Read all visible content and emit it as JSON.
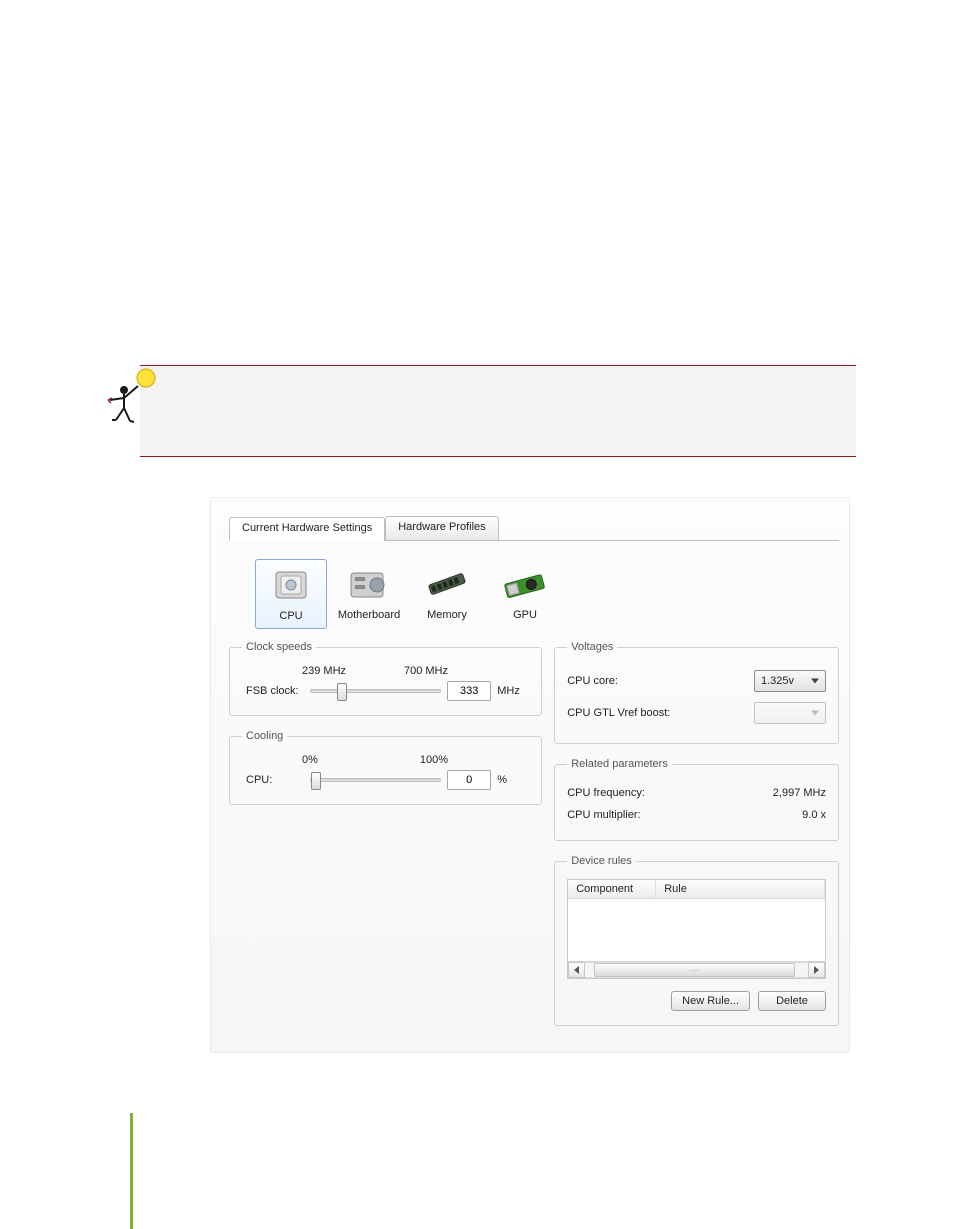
{
  "tabs": {
    "active": "Current Hardware Settings",
    "inactive": "Hardware Profiles"
  },
  "categories": [
    {
      "key": "cpu",
      "label": "CPU",
      "active": true
    },
    {
      "key": "motherboard",
      "label": "Motherboard",
      "active": false
    },
    {
      "key": "memory",
      "label": "Memory",
      "active": false
    },
    {
      "key": "gpu",
      "label": "GPU",
      "active": false
    }
  ],
  "clockSpeeds": {
    "legend": "Clock speeds",
    "fsb": {
      "label": "FSB clock:",
      "min": "239 MHz",
      "max": "700 MHz",
      "value": "333",
      "unit": "MHz",
      "thumbPercent": 20
    }
  },
  "cooling": {
    "legend": "Cooling",
    "cpu": {
      "label": "CPU:",
      "min": "0%",
      "max": "100%",
      "value": "0",
      "unit": "%",
      "thumbPercent": 0
    }
  },
  "voltages": {
    "legend": "Voltages",
    "rows": [
      {
        "label": "CPU core:",
        "value": "1.325v",
        "enabled": true
      },
      {
        "label": "CPU GTL Vref boost:",
        "value": "",
        "enabled": false
      }
    ]
  },
  "related": {
    "legend": "Related parameters",
    "rows": [
      {
        "label": "CPU frequency:",
        "value": "2,997 MHz"
      },
      {
        "label": "CPU multiplier:",
        "value": "9.0 x"
      }
    ]
  },
  "deviceRules": {
    "legend": "Device rules",
    "headers": {
      "component": "Component",
      "rule": "Rule"
    },
    "newRule": "New Rule...",
    "delete": "Delete"
  }
}
